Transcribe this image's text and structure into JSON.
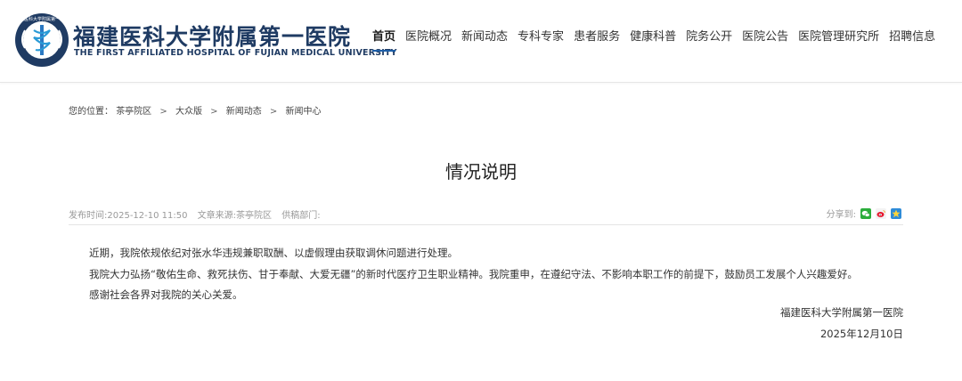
{
  "header": {
    "name_cn": "福建医科大学附属第一医院",
    "name_en": "THE FIRST AFFILIATED HOSPITAL OF FUJIAN MEDICAL UNIVERSITY",
    "logo_ring_text": "福建医科大学附属第一医院",
    "nav": [
      "首页",
      "医院概况",
      "新闻动态",
      "专科专家",
      "患者服务",
      "健康科普",
      "院务公开",
      "医院公告",
      "医院管理研究所",
      "招聘信息"
    ],
    "active_nav": "首页",
    "brand_color": "#1e5fa8"
  },
  "breadcrumb": {
    "prefix": "您的位置：",
    "items": [
      "茶亭院区",
      "大众版",
      "新闻动态",
      "新闻中心"
    ],
    "separator": ">"
  },
  "article": {
    "title": "情况说明",
    "publish_time": "发布时间:2025-12-10 11:50",
    "source": "文章来源:茶亭院区",
    "provider": "供稿部门:",
    "share_label": "分享到:",
    "share_icons": [
      "wechat-icon",
      "weibo-icon",
      "qzone-icon"
    ],
    "paragraphs": [
      "近期，我院依规依纪对张水华违规兼职取酬、以虚假理由获取调休问题进行处理。",
      "我院大力弘扬“敬佑生命、救死扶伤、甘于奉献、大爱无疆”的新时代医疗卫生职业精神。我院重申，在遵纪守法、不影响本职工作的前提下，鼓励员工发展个人兴趣爱好。",
      "感谢社会各界对我院的关心关爱。"
    ],
    "signature": "福建医科大学附属第一医院",
    "date": "2025年12月10日"
  }
}
